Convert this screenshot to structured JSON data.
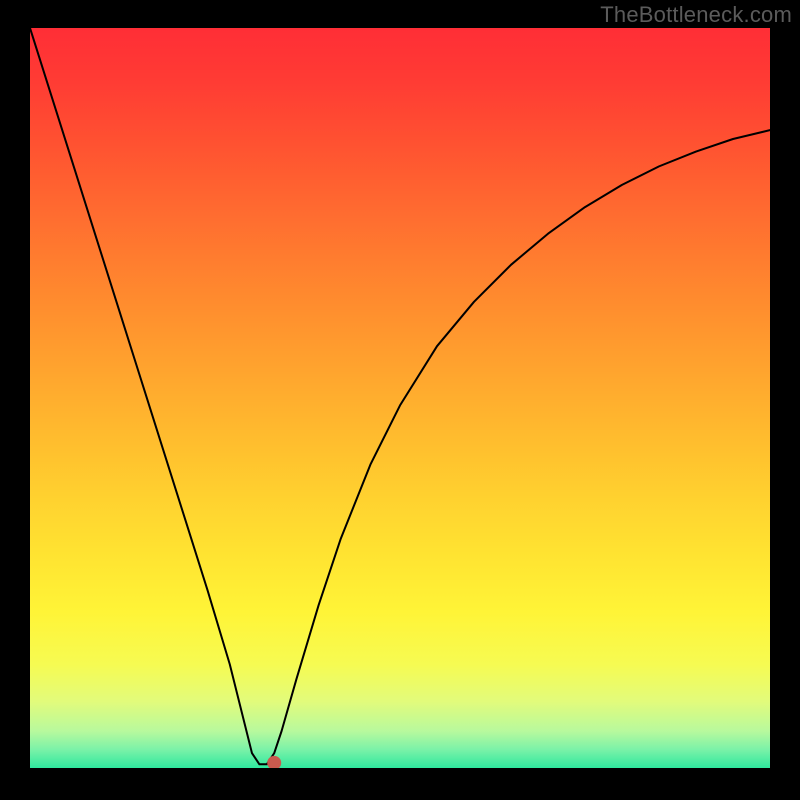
{
  "watermark": "TheBottleneck.com",
  "chart_data": {
    "type": "line",
    "title": "",
    "xlabel": "",
    "ylabel": "",
    "xlim": [
      0,
      100
    ],
    "ylim": [
      0,
      100
    ],
    "x": [
      0,
      3,
      6,
      9,
      12,
      15,
      18,
      21,
      24,
      27,
      29,
      30,
      31,
      32,
      33,
      34,
      36,
      39,
      42,
      46,
      50,
      55,
      60,
      65,
      70,
      75,
      80,
      85,
      90,
      95,
      100
    ],
    "y": [
      100,
      90.5,
      81,
      71.5,
      62,
      52.5,
      43,
      33.5,
      24,
      14,
      6,
      2,
      0.5,
      0.5,
      2,
      5,
      12,
      22,
      31,
      41,
      49,
      57,
      63,
      68,
      72.2,
      75.8,
      78.8,
      81.3,
      83.3,
      85,
      86.2
    ],
    "series_curve": {
      "name": "bottleneck-curve",
      "color": "#000000",
      "stroke_width": 2
    },
    "marker": {
      "x": 33,
      "y": 0.7,
      "color": "#c95a4e",
      "radius": 7
    },
    "background_gradient": {
      "stops": [
        {
          "offset": 0.0,
          "color": "#ff2e36"
        },
        {
          "offset": 0.07,
          "color": "#ff3b34"
        },
        {
          "offset": 0.15,
          "color": "#ff5031"
        },
        {
          "offset": 0.23,
          "color": "#ff6630"
        },
        {
          "offset": 0.31,
          "color": "#ff7c2f"
        },
        {
          "offset": 0.39,
          "color": "#ff912e"
        },
        {
          "offset": 0.47,
          "color": "#ffa62e"
        },
        {
          "offset": 0.55,
          "color": "#ffbb2e"
        },
        {
          "offset": 0.63,
          "color": "#ffd02f"
        },
        {
          "offset": 0.71,
          "color": "#ffe331"
        },
        {
          "offset": 0.79,
          "color": "#fff437"
        },
        {
          "offset": 0.86,
          "color": "#f6fb52"
        },
        {
          "offset": 0.91,
          "color": "#e2fb7b"
        },
        {
          "offset": 0.95,
          "color": "#b8f99d"
        },
        {
          "offset": 0.975,
          "color": "#7bf2a8"
        },
        {
          "offset": 1.0,
          "color": "#2fe89e"
        }
      ]
    }
  }
}
